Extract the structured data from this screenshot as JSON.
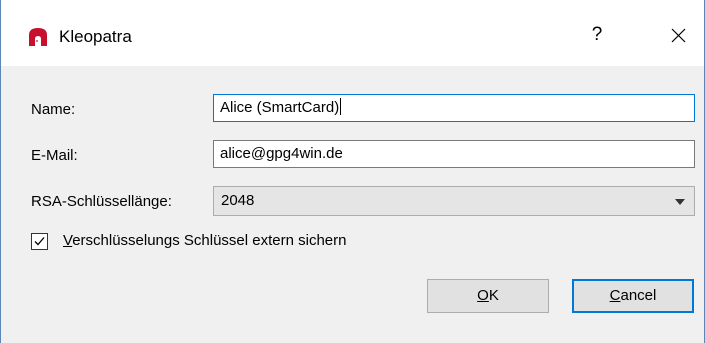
{
  "window": {
    "title": "Kleopatra",
    "help_label": "?",
    "app_icon": "kleopatra-logo-icon",
    "close_icon": "close-icon"
  },
  "form": {
    "name_label": "Name:",
    "name_value": "Alice (SmartCard)",
    "email_label": "E-Mail:",
    "email_value": "alice@gpg4win.de",
    "keylength_label": "RSA-Schlüssellänge:",
    "keylength_value": "2048",
    "backup_checked": true,
    "backup_label_first": "V",
    "backup_label_rest": "erschlüsselungs Schlüssel extern sichern"
  },
  "buttons": {
    "ok_first": "O",
    "ok_rest": "K",
    "cancel_first": "C",
    "cancel_rest": "ancel"
  },
  "colors": {
    "accent": "#0078d7",
    "icon_red": "#c8102e",
    "dialog_bg": "#f0f0f0"
  }
}
